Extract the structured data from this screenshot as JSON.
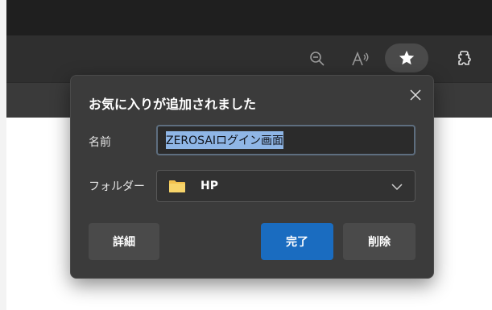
{
  "toolbar": {
    "icons": [
      "zoom-out-icon",
      "read-aloud-icon",
      "favorite-star-icon",
      "extensions-icon"
    ]
  },
  "dialog": {
    "title": "お気に入りが追加されました",
    "name_label": "名前",
    "name_value": "ZEROSAIログイン画面",
    "folder_label": "フォルダー",
    "folder_value": "HP",
    "buttons": {
      "detail": "詳細",
      "done": "完了",
      "delete": "削除"
    }
  },
  "colors": {
    "accent": "#1a6cc0",
    "dialog_bg": "#3b3b3b",
    "selection": "#8fb6e6",
    "folder": "#f2c14e"
  }
}
